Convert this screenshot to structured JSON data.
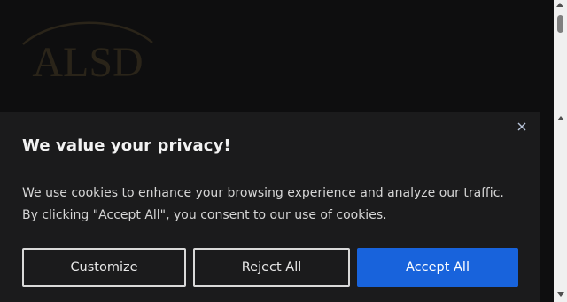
{
  "site": {
    "logo_text": "ALSD",
    "logo_color": "#2a2419"
  },
  "cookie_banner": {
    "title": "We value your privacy!",
    "body": "We use cookies to enhance your browsing experience and analyze our traffic. By clicking \"Accept All\", you consent to our use of cookies.",
    "close_icon": "close-icon",
    "buttons": {
      "customize": "Customize",
      "reject": "Reject All",
      "accept": "Accept All"
    },
    "accent_color": "#1863dc",
    "background_color": "#1b1b1c"
  }
}
